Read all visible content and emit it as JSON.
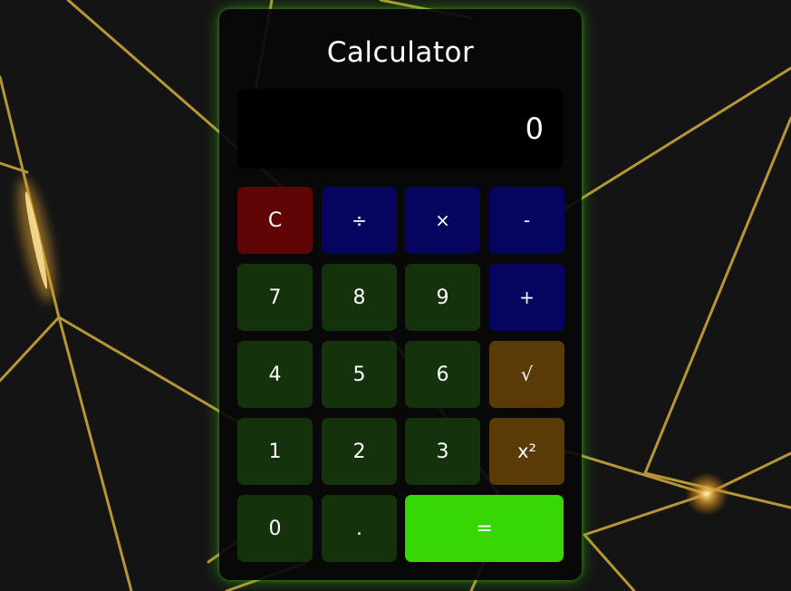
{
  "app": {
    "title": "Calculator",
    "display_value": "0"
  },
  "colors": {
    "page_background": "#141414",
    "panel_background": "#080808",
    "panel_glow": "#46c81e",
    "number_button": "#14320b",
    "clear_button": "#600505",
    "operator_button": "#050560",
    "function_button": "#5a3a06",
    "equals_button": "#37d605",
    "background_lines": "#d9b23a"
  },
  "keys": {
    "clear": "C",
    "divide": "÷",
    "multiply": "×",
    "subtract": "-",
    "seven": "7",
    "eight": "8",
    "nine": "9",
    "add": "+",
    "four": "4",
    "five": "5",
    "six": "6",
    "sqrt": "√",
    "one": "1",
    "two": "2",
    "three": "3",
    "square": "x²",
    "zero": "0",
    "decimal": ".",
    "equals": "="
  }
}
